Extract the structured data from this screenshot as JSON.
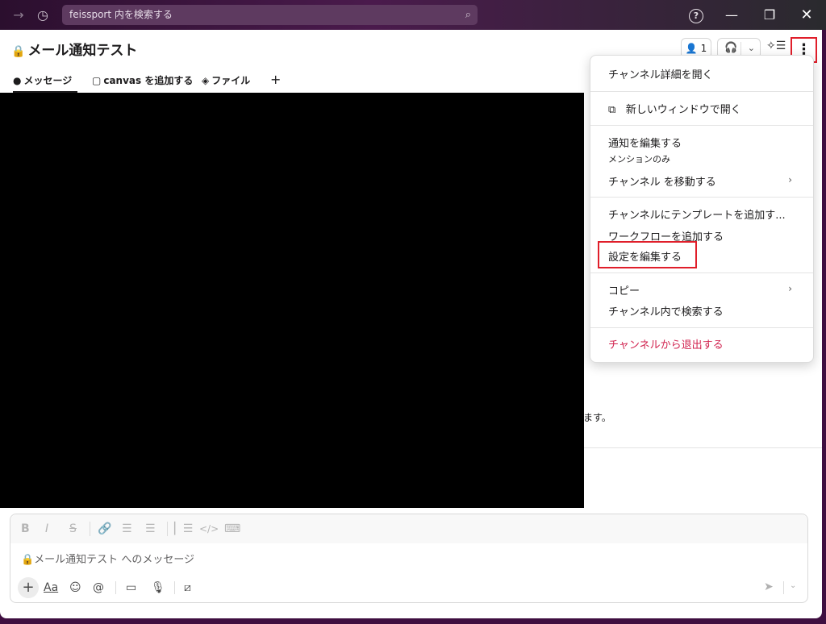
{
  "titlebar": {
    "search_placeholder": "feissport 内を検索する",
    "forward_icon": "→",
    "history_icon": "◷",
    "search_icon": "⌕",
    "help_icon": "?",
    "minimize_icon": "—",
    "maximize_icon": "❐",
    "close_icon": "✕"
  },
  "header": {
    "channel_name": "メール通知テスト",
    "lock_icon": "🔒",
    "members_count": "1",
    "member_icon": "👤",
    "headphones_icon": "🎧",
    "chevron_icon": "⌄",
    "ai_icon": "✧☰",
    "more_icon": "⋮"
  },
  "tabs": {
    "messages": "メッセージ",
    "canvas": "canvas を追加する",
    "files": "ファイル",
    "add": "+"
  },
  "background": {
    "partial_text": "ます。"
  },
  "composer": {
    "placeholder": "🔒メール通知テスト へのメッセージ",
    "format_icons": [
      "B",
      "I",
      "S",
      "🔗",
      "☰",
      "☰",
      "▏☰",
      "</>",
      "⌨"
    ],
    "plus": "+",
    "aa": "Aa",
    "emoji": "☺",
    "mention": "@",
    "video": "▭",
    "mic": "🎙",
    "slash": "⧄",
    "send": "➤",
    "send_chevron": "⌄"
  },
  "menu": {
    "open_details": "チャンネル詳細を開く",
    "open_new_window": "新しいウィンドウで開く",
    "new_window_icon": "⧉",
    "edit_notifications": "通知を編集する",
    "notification_state": "メンションのみ",
    "move_channel": "チャンネル を移動する",
    "add_template": "チャンネルにテンプレートを追加す...",
    "add_workflow": "ワークフローを追加する",
    "edit_settings": "設定を編集する",
    "copy": "コピー",
    "search_in_channel": "チャンネル内で検索する",
    "leave_channel": "チャンネルから退出する",
    "submenu_arrow": "›"
  }
}
